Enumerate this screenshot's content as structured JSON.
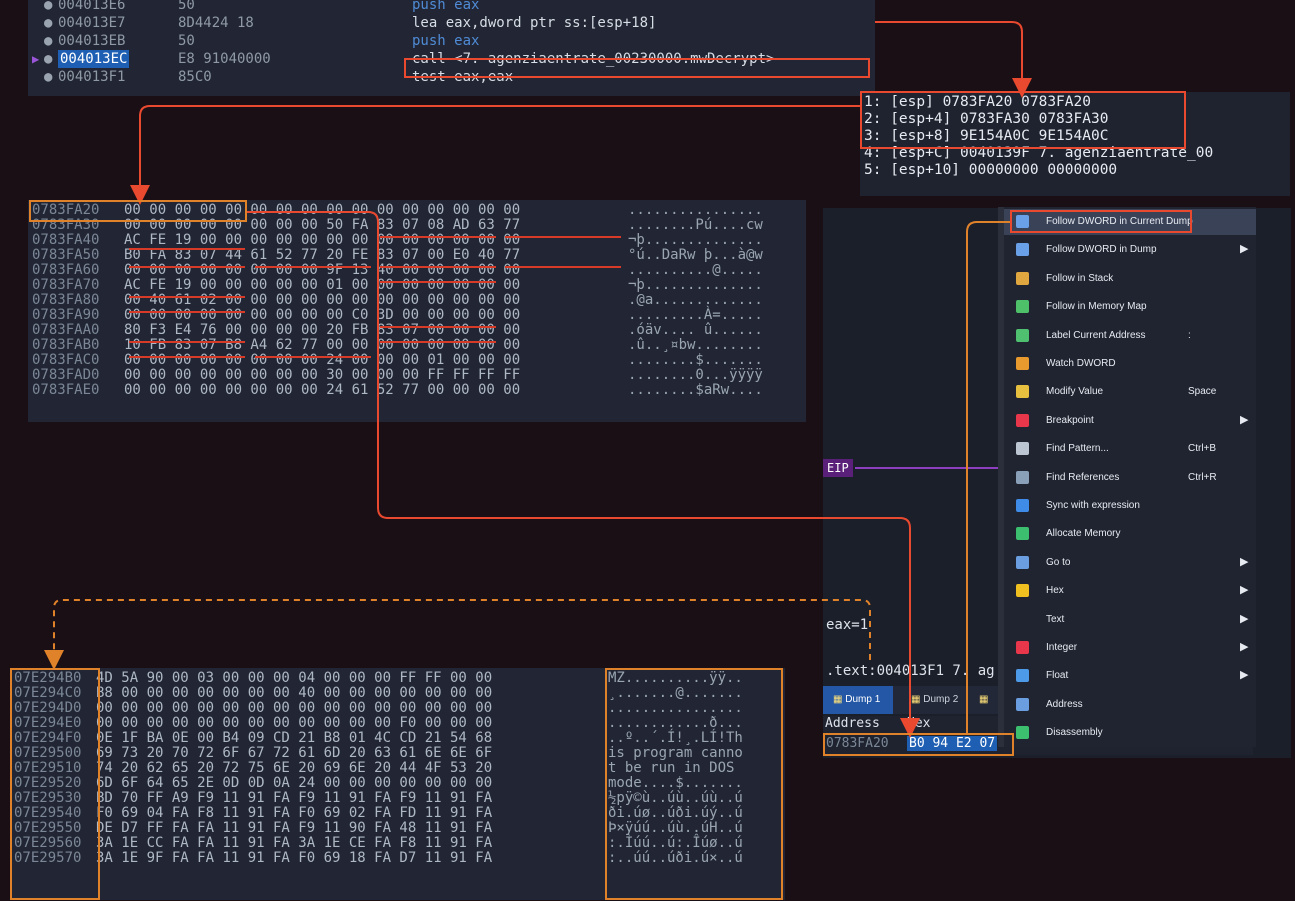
{
  "disasm": {
    "rows": [
      {
        "addr": "004013E6",
        "bytes": "50",
        "ins": "push eax",
        "blue": true
      },
      {
        "addr": "004013E7",
        "bytes": "8D4424 18",
        "ins": "lea eax,dword ptr ss:[esp+18]",
        "blue": false
      },
      {
        "addr": "004013EB",
        "bytes": "50",
        "ins": "push eax",
        "blue": true
      },
      {
        "addr": "004013EC",
        "bytes": "E8 91040000",
        "ins": "call <7. agenziaentrate_00230000.mwDecrypt>",
        "blue": false
      },
      {
        "addr": "004013F1",
        "bytes": "85C0",
        "ins": "test eax,eax",
        "blue": false
      }
    ]
  },
  "stack": {
    "rows": [
      "1: [esp] 0783FA20 0783FA20",
      "2: [esp+4] 0783FA30 0783FA30",
      "3: [esp+8] 9E154A0C 9E154A0C",
      "4: [esp+C] 0040139F 7. agenziaentrate_00",
      "5: [esp+10] 00000000 00000000"
    ]
  },
  "dump1": {
    "rows": [
      {
        "a": "0783FA20",
        "h": "00 00 00 00 00 00 00 00 00 00 00 00 00 00 00 00",
        "t": "................"
      },
      {
        "a": "0783FA30",
        "h": "00 00 00 00 00 00 00 00 50 FA 83 07 08 AD 63 77",
        "t": "........Pú....cw"
      },
      {
        "a": "0783FA40",
        "h": "AC FE 19 00 00 00 00 00 00 00 00 00 00 00 00 00",
        "t": "¬þ.............."
      },
      {
        "a": "0783FA50",
        "h": "B0 FA 83 07 44 61 52 77 20 FE 83 07 00 E0 40 77",
        "t": "°ú..DaRw þ...à@w"
      },
      {
        "a": "0783FA60",
        "h": "00 00 00 00 00 00 00 00 9F 13 40 00 00 00 00 00",
        "t": "..........@....."
      },
      {
        "a": "0783FA70",
        "h": "AC FE 19 00 00 00 00 00 01 00 00 00 00 00 00 00",
        "t": "¬þ.............."
      },
      {
        "a": "0783FA80",
        "h": "00 40 61 02 00 00 00 00 00 00 00 00 00 00 00 00",
        "t": ".@a............."
      },
      {
        "a": "0783FA90",
        "h": "00 00 00 00 00 00 00 00 00 C0 3D 00 00 00 00 00",
        "t": ".........À=....."
      },
      {
        "a": "0783FAA0",
        "h": "80 F3 E4 76 00 00 00 00 20 FB 83 07 00 00 00 00",
        "t": ".óäv.... û......"
      },
      {
        "a": "0783FAB0",
        "h": "10 FB 83 07 B8 A4 62 77 00 00 00 00 00 00 00 00",
        "t": ".û..¸¤bw........"
      },
      {
        "a": "0783FAC0",
        "h": "00 00 00 00 00 00 00 00 24 00 00 00 01 00 00 00",
        "t": "........$......."
      },
      {
        "a": "0783FAD0",
        "h": "00 00 00 00 00 00 00 00 30 00 00 00 FF FF FF FF",
        "t": "........0...ÿÿÿÿ"
      },
      {
        "a": "0783FAE0",
        "h": "00 00 00 00 00 00 00 00 24 61 52 77 00 00 00 00",
        "t": "........$aRw...."
      }
    ]
  },
  "dump2": {
    "rows": [
      {
        "a": "07E294B0",
        "h": "4D 5A 90 00 03 00 00 00 04 00 00 00 FF FF 00 00",
        "t": "MZ..........ÿÿ.."
      },
      {
        "a": "07E294C0",
        "h": "B8 00 00 00 00 00 00 00 40 00 00 00 00 00 00 00",
        "t": "¸.......@......."
      },
      {
        "a": "07E294D0",
        "h": "00 00 00 00 00 00 00 00 00 00 00 00 00 00 00 00",
        "t": "................"
      },
      {
        "a": "07E294E0",
        "h": "00 00 00 00 00 00 00 00 00 00 00 00 F0 00 00 00",
        "t": "............ð..."
      },
      {
        "a": "07E294F0",
        "h": "0E 1F BA 0E 00 B4 09 CD 21 B8 01 4C CD 21 54 68",
        "t": "..º..´.Í!¸.LÍ!Th"
      },
      {
        "a": "07E29500",
        "h": "69 73 20 70 72 6F 67 72 61 6D 20 63 61 6E 6E 6F",
        "t": "is program canno"
      },
      {
        "a": "07E29510",
        "h": "74 20 62 65 20 72 75 6E 20 69 6E 20 44 4F 53 20",
        "t": "t be run in DOS "
      },
      {
        "a": "07E29520",
        "h": "6D 6F 64 65 2E 0D 0D 0A 24 00 00 00 00 00 00 00",
        "t": "mode....$......."
      },
      {
        "a": "07E29530",
        "h": "BD 70 FF A9 F9 11 91 FA F9 11 91 FA F9 11 91 FA",
        "t": "½pÿ©ù..úù..úù..ú"
      },
      {
        "a": "07E29540",
        "h": "F0 69 04 FA F8 11 91 FA F0 69 02 FA FD 11 91 FA",
        "t": "ði.úø..úði.úý..ú"
      },
      {
        "a": "07E29550",
        "h": "DE D7 FF FA FA 11 91 FA F9 11 90 FA 48 11 91 FA",
        "t": "Þ×ÿúú..úù..úH..ú"
      },
      {
        "a": "07E29560",
        "h": "3A 1E CC FA FA 11 91 FA 3A 1E CE FA F8 11 91 FA",
        "t": ":.Ìúú..ú:.Îúø..ú"
      },
      {
        "a": "07E29570",
        "h": "3A 1E 9F FA FA 11 91 FA F0 69 18 FA D7 11 91 FA",
        "t": ":..úú..úði.ú×..ú"
      }
    ]
  },
  "menu": {
    "items": [
      {
        "label": "Follow DWORD in Current Dump",
        "shortcut": "",
        "sub": false,
        "icon": "dump-icon",
        "color": "#6aa0e8"
      },
      {
        "label": "Follow DWORD in Dump",
        "shortcut": "",
        "sub": true,
        "icon": "dump-icon",
        "color": "#6aa0e8"
      },
      {
        "label": "Follow in Stack",
        "shortcut": "",
        "sub": false,
        "icon": "stack-icon",
        "color": "#e0a640"
      },
      {
        "label": "Follow in Memory Map",
        "shortcut": "",
        "sub": false,
        "icon": "memory-map-icon",
        "color": "#4fc06a"
      },
      {
        "label": "Label Current Address",
        "shortcut": ":",
        "sub": false,
        "icon": "label-icon",
        "color": "#4fbf70"
      },
      {
        "label": "Watch DWORD",
        "shortcut": "",
        "sub": false,
        "icon": "watch-icon",
        "color": "#e89a2e"
      },
      {
        "label": "Modify Value",
        "shortcut": "Space",
        "sub": false,
        "icon": "pencil-icon",
        "color": "#e8c040"
      },
      {
        "label": "Breakpoint",
        "shortcut": "",
        "sub": true,
        "icon": "breakpoint-icon",
        "color": "#e8364a"
      },
      {
        "label": "Find Pattern...",
        "shortcut": "Ctrl+B",
        "sub": false,
        "icon": "find-pattern-icon",
        "color": "#bcc6d2"
      },
      {
        "label": "Find References",
        "shortcut": "Ctrl+R",
        "sub": false,
        "icon": "find-references-icon",
        "color": "#8aa0b8"
      },
      {
        "label": "Sync with expression",
        "shortcut": "",
        "sub": false,
        "icon": "sync-icon",
        "color": "#3e8ce8"
      },
      {
        "label": "Allocate Memory",
        "shortcut": "",
        "sub": false,
        "icon": "allocate-memory-icon",
        "color": "#3cbf6e"
      },
      {
        "label": "Go to",
        "shortcut": "",
        "sub": true,
        "icon": "goto-icon",
        "color": "#6a9ee0"
      },
      {
        "label": "Hex",
        "shortcut": "",
        "sub": true,
        "icon": "hex-icon",
        "color": "#f0c020"
      },
      {
        "label": "Text",
        "shortcut": "",
        "sub": true,
        "icon": "text-icon",
        "color": "#1f2430"
      },
      {
        "label": "Integer",
        "shortcut": "",
        "sub": true,
        "icon": "integer-icon",
        "color": "#e8364a"
      },
      {
        "label": "Float",
        "shortcut": "",
        "sub": true,
        "icon": "float-icon",
        "color": "#4c9ae8"
      },
      {
        "label": "Address",
        "shortcut": "",
        "sub": false,
        "icon": "address-icon",
        "color": "#6a9ee0"
      },
      {
        "label": "Disassembly",
        "shortcut": "",
        "sub": false,
        "icon": "disassembly-icon",
        "color": "#3cbf6e"
      }
    ]
  },
  "right": {
    "eip": "EIP",
    "eax": "eax=1",
    "text_line": ".text:004013F1 7. ag",
    "tabs": [
      "Dump 1",
      "Dump 2"
    ],
    "dump_header_addr": "Address",
    "dump_header_hex": "Hex",
    "dump_row_addr": "0783FA20",
    "dump_row_hex": "B0 94 E2 07"
  },
  "colors": {
    "annotation_red": "#e8492f",
    "annotation_orange": "#e0822a",
    "selection_blue": "#1e5fb3"
  }
}
